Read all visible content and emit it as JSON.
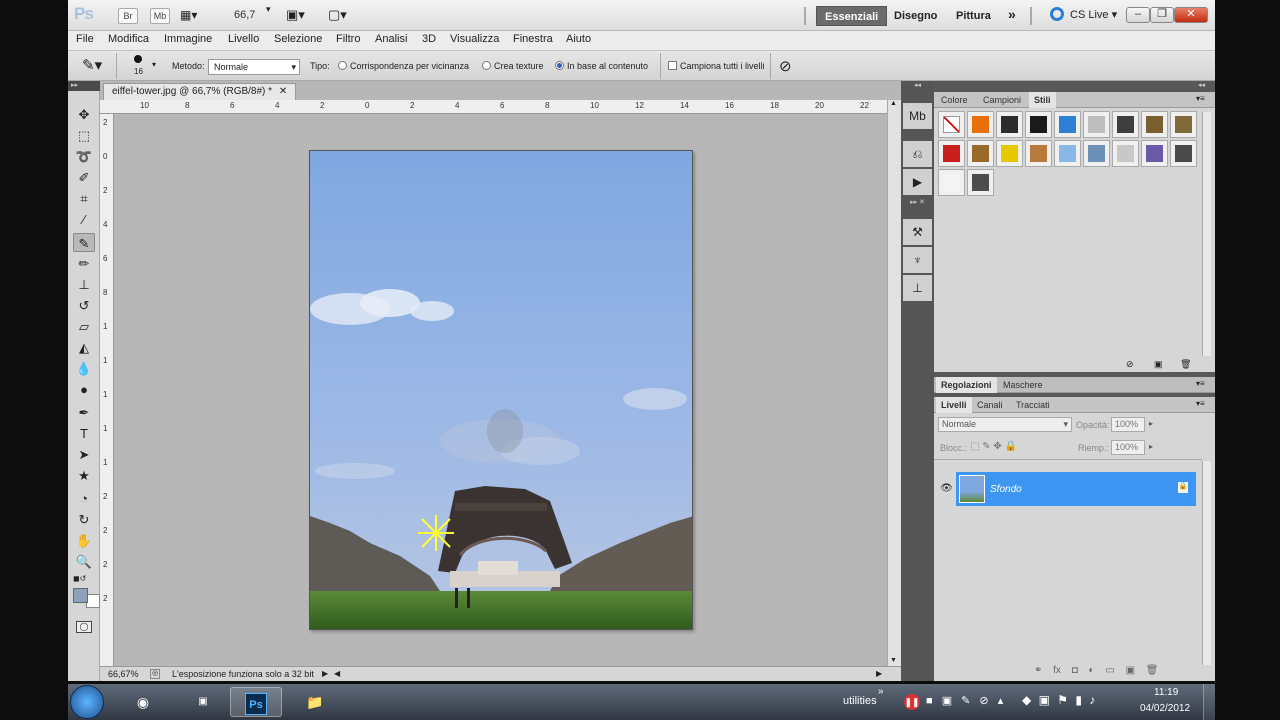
{
  "app": {
    "logo": "Ps",
    "bridge_btn": "Br",
    "minibridge_btn": "Mb",
    "zoom_value": "66,7",
    "workspaces": [
      "Essenziali",
      "Disegno",
      "Pittura"
    ],
    "more_icon": "double-chevron-right-icon",
    "cs_live": "CS Live"
  },
  "menu": [
    "File",
    "Modifica",
    "Immagine",
    "Livello",
    "Selezione",
    "Filtro",
    "Analisi",
    "3D",
    "Visualizza",
    "Finestra",
    "Aiuto"
  ],
  "options": {
    "brush_size": "16",
    "metodo_label": "Metodo:",
    "metodo_value": "Normale",
    "tipo_label": "Tipo:",
    "tipo_options": [
      "Corrispondenza per vicinanza",
      "Crea texture",
      "In base al contenuto"
    ],
    "tipo_selected": "In base al contenuto",
    "sample_all": "Campiona tutti i livelli"
  },
  "document": {
    "tab_title": "eiffel-tower.jpg @ 66,7% (RGB/8#) *",
    "ruler_h_labels": [
      "10",
      "8",
      "6",
      "4",
      "2",
      "0",
      "2",
      "4",
      "6",
      "8",
      "10",
      "12",
      "14",
      "16",
      "18",
      "20",
      "22"
    ],
    "ruler_v_labels": [
      "2",
      "0",
      "2",
      "4",
      "6",
      "8",
      "1",
      "1",
      "1",
      "1",
      "1",
      "2",
      "2",
      "2",
      "2"
    ],
    "zoom_status": "66,67%",
    "status_message": "L'esposizione funziona solo a 32 bit"
  },
  "panels": {
    "top_tabs": [
      "Colore",
      "Campioni",
      "Stili"
    ],
    "top_active": "Stili",
    "mid_tabs": [
      "Regolazioni",
      "Maschere"
    ],
    "layer_tabs": [
      "Livelli",
      "Canali",
      "Tracciati"
    ],
    "blend_mode": "Normale",
    "opacity_label": "Opacità:",
    "opacity_value": "100%",
    "lock_label": "Blocc.:",
    "fill_label": "Riemp.:",
    "fill_value": "100%",
    "layer_name": "Sfondo",
    "style_colors": [
      "#ffffff",
      "#e8700a",
      "#2c2c2c",
      "#1a1a1a",
      "#2f7fd6",
      "#bdbdbd",
      "#3e3e3e",
      "#7a6030",
      "#806a3a",
      "#c81e1e",
      "#9a6a2a",
      "#e6c800",
      "#b87a3a",
      "#8ab8e6",
      "#6b8fb5",
      "#c8c8c8",
      "#6a5aa8",
      "#4a4a4a",
      "#f4f4f4",
      "#4d4d4d"
    ]
  },
  "taskbar": {
    "utilities": "utilities",
    "time": "11:19",
    "date": "04/02/2012"
  }
}
